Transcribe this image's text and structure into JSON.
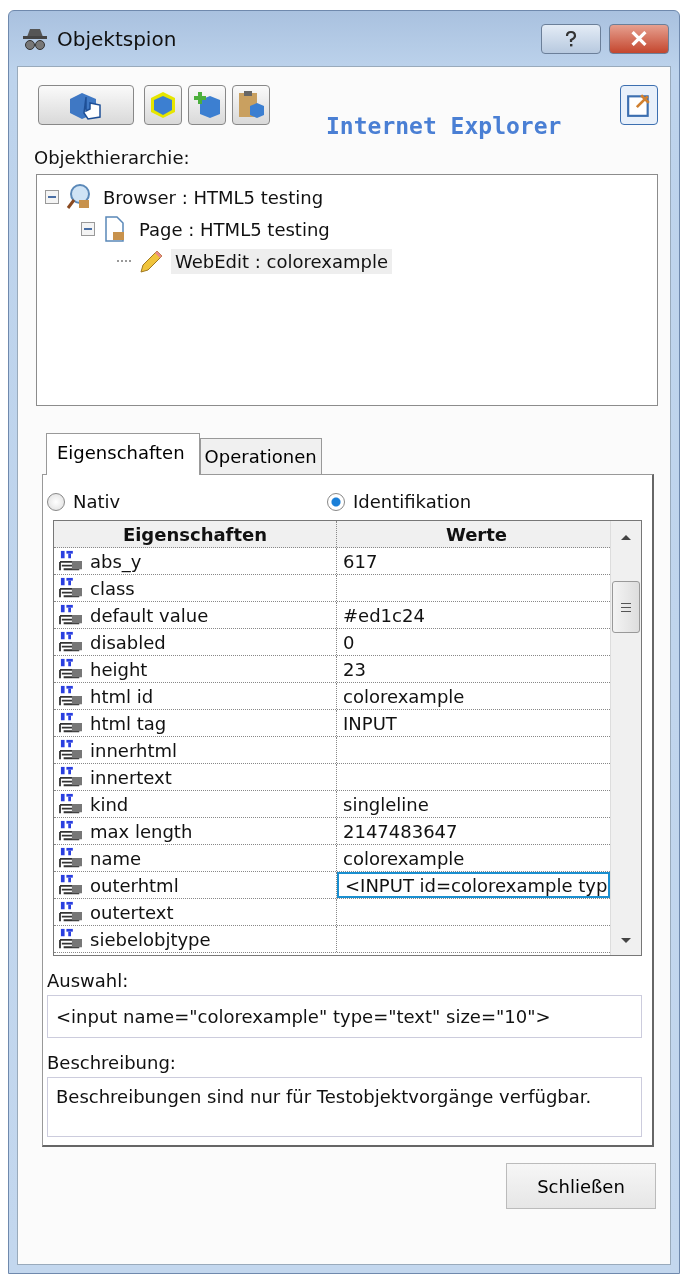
{
  "window": {
    "title": "Objektspion"
  },
  "toolbar": {
    "environment": "Internet Explorer"
  },
  "hierarchy": {
    "label": "Objekthierarchie:",
    "tree": [
      {
        "kind": "browser",
        "label": "Browser : HTML5 testing",
        "expanded": true,
        "selected": false,
        "children": [
          {
            "kind": "page",
            "label": "Page : HTML5 testing",
            "expanded": true,
            "selected": false,
            "children": [
              {
                "kind": "edit",
                "label": "WebEdit : colorexample",
                "selected": true
              }
            ]
          }
        ]
      }
    ]
  },
  "tabs": [
    {
      "label": "Eigenschaften",
      "selected": true
    },
    {
      "label": "Operationen",
      "selected": false
    }
  ],
  "modes": [
    {
      "label": "Nativ",
      "selected": false
    },
    {
      "label": "Identifikation",
      "selected": true
    }
  ],
  "grid": {
    "columns": [
      "Eigenschaften",
      "Werte"
    ],
    "rows": [
      {
        "property": "abs_y",
        "value": "617",
        "focused": false
      },
      {
        "property": "class",
        "value": "",
        "focused": false
      },
      {
        "property": "default value",
        "value": "#ed1c24",
        "focused": false
      },
      {
        "property": "disabled",
        "value": "0",
        "focused": false
      },
      {
        "property": "height",
        "value": "23",
        "focused": false
      },
      {
        "property": "html id",
        "value": "colorexample",
        "focused": false
      },
      {
        "property": "html tag",
        "value": "INPUT",
        "focused": false
      },
      {
        "property": "innerhtml",
        "value": "",
        "focused": false
      },
      {
        "property": "innertext",
        "value": "",
        "focused": false
      },
      {
        "property": "kind",
        "value": "singleline",
        "focused": false
      },
      {
        "property": "max length",
        "value": "2147483647",
        "focused": false
      },
      {
        "property": "name",
        "value": "colorexample",
        "focused": false
      },
      {
        "property": "outerhtml",
        "value": "<INPUT id=colorexample typ",
        "focused": true
      },
      {
        "property": "outertext",
        "value": "",
        "focused": false
      },
      {
        "property": "siebelobjtype",
        "value": "",
        "focused": false
      }
    ]
  },
  "selection": {
    "label": "Auswahl:",
    "value": "<input name=\"colorexample\" type=\"text\" size=\"10\">"
  },
  "description": {
    "label": "Beschreibung:",
    "value": "Beschreibungen sind nur für Testobjektvorgänge verfügbar."
  },
  "close_button": "Schließen"
}
